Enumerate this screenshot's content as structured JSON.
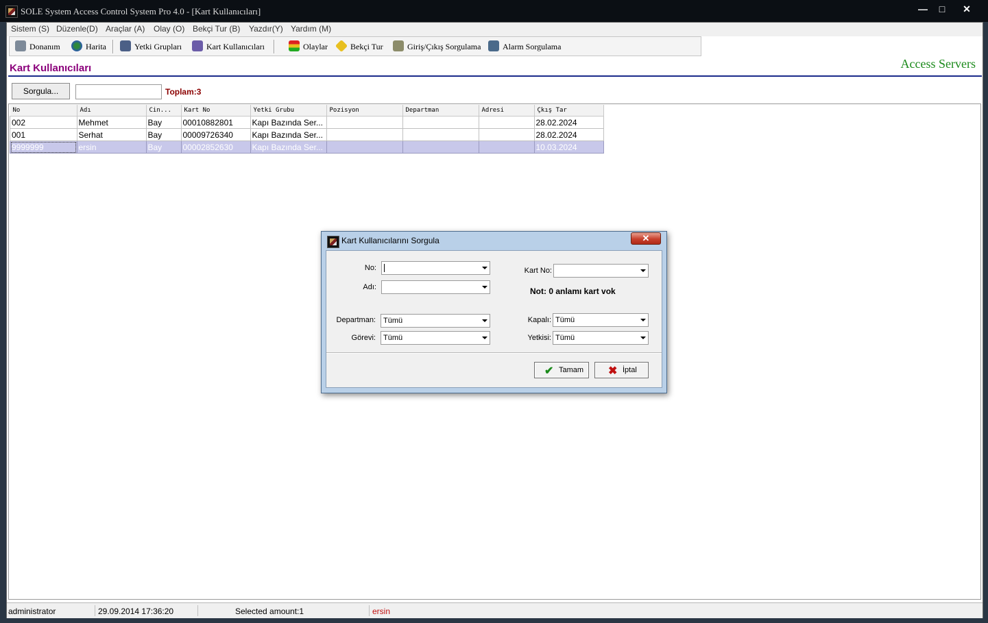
{
  "window": {
    "title": "SOLE System Access Control System Pro 4.0 - [Kart Kullanıcıları]",
    "minimize": "—",
    "maximize": "□",
    "close": "✕"
  },
  "menu": {
    "items": [
      "Sistem (S)",
      "Düzenle(D)",
      "Araçlar (A)",
      "Olay (O)",
      "Bekçi Tur (B)",
      "Yazdır(Y)",
      "Yardım (M)"
    ]
  },
  "toolbar": {
    "donanim": "Donanım",
    "harita": "Harita",
    "yetki_gruplari": "Yetki Grupları",
    "kart_kullanicilari": "Kart Kullanıcıları",
    "olaylar": "Olaylar",
    "bekci_tur": "Bekçi Tur",
    "giris_cikis": "Giriş/Çıkış Sorgulama",
    "alarm": "Alarm Sorgulama"
  },
  "page": {
    "title": "Kart Kullanıcıları",
    "servers_link": "Access Servers",
    "query_button": "Sorgula...",
    "search_value": "",
    "total": "Toplam:3"
  },
  "grid": {
    "columns": [
      "No",
      "Adı",
      "Cin...",
      "Kart No",
      "Yetki Grubu",
      "Pozisyon",
      "Departman",
      "Adresi",
      "Çkış Tar"
    ],
    "rows": [
      [
        "002",
        "Mehmet",
        "Bay",
        "00010882801",
        "Kapı Bazında Ser...",
        "",
        "",
        "",
        "28.02.2024"
      ],
      [
        "001",
        "Serhat",
        "Bay",
        "00009726340",
        "Kapı Bazında Ser...",
        "",
        "",
        "",
        "28.02.2024"
      ],
      [
        "9999999",
        "ersin",
        "Bay",
        "00002852630",
        "Kapı Bazında Ser...",
        "",
        "",
        "",
        "10.03.2024"
      ]
    ],
    "selected_row": 2
  },
  "status": {
    "user": "administrator",
    "datetime": "29.09.2014 17:36:20",
    "selected": "Selected amount:1",
    "selected_name": "ersin"
  },
  "dialog": {
    "title": "Kart Kullanıcılarını Sorgula",
    "close": "✕",
    "no_label": "No:",
    "no_value": "",
    "adi_label": "Adı:",
    "adi_value": "",
    "kart_no_label": "Kart No:",
    "kart_no_value": "",
    "note": "Not: 0 anlamı kart vok",
    "departman_label": "Departman:",
    "departman_value": "Tümü",
    "gorevi_label": "Görevi:",
    "gorevi_value": "Tümü",
    "kapali_label": "Kapalı:",
    "kapali_value": "Tümü",
    "yetkisi_label": "Yetkisi:",
    "yetkisi_value": "Tümü",
    "ok_label": "Tamam",
    "cancel_label": "İptal"
  },
  "colors": {
    "page_title": "#8b007b",
    "servers": "#1a8a1a",
    "total": "#8b0000",
    "selected_row": "#c8c8ea",
    "ok_check": "#1a8a1a",
    "cancel_x": "#c01010"
  }
}
